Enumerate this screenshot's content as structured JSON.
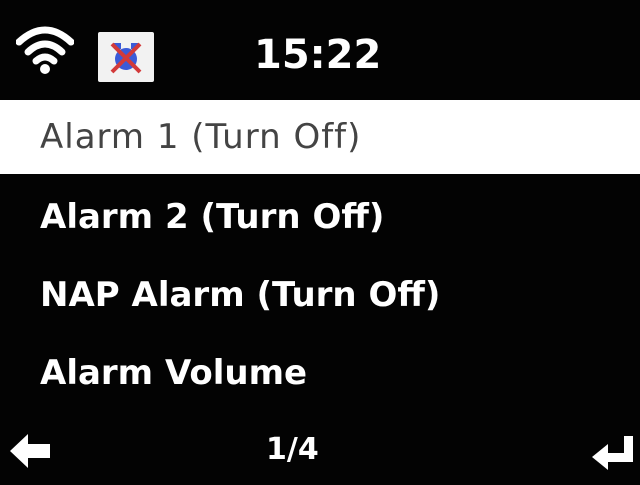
{
  "status_bar": {
    "wifi_icon": "wifi-icon",
    "alarm_status_icon": "alarm-muted-icon",
    "time": "15:22"
  },
  "menu": {
    "items": [
      {
        "label": "Alarm 1 (Turn Off)",
        "selected": true
      },
      {
        "label": "Alarm 2 (Turn Off)",
        "selected": false
      },
      {
        "label": "NAP Alarm (Turn Off)",
        "selected": false
      },
      {
        "label": "Alarm Volume",
        "selected": false
      }
    ]
  },
  "footer": {
    "back_icon": "left-arrow-icon",
    "page": "1/4",
    "enter_icon": "enter-return-icon"
  },
  "colors": {
    "background": "#030303",
    "selected_row": "#ffffff",
    "selected_text": "#444444",
    "text": "#ffffff",
    "alarm_icon_red": "#d23a3a",
    "alarm_icon_blue": "#3b5bd8"
  }
}
